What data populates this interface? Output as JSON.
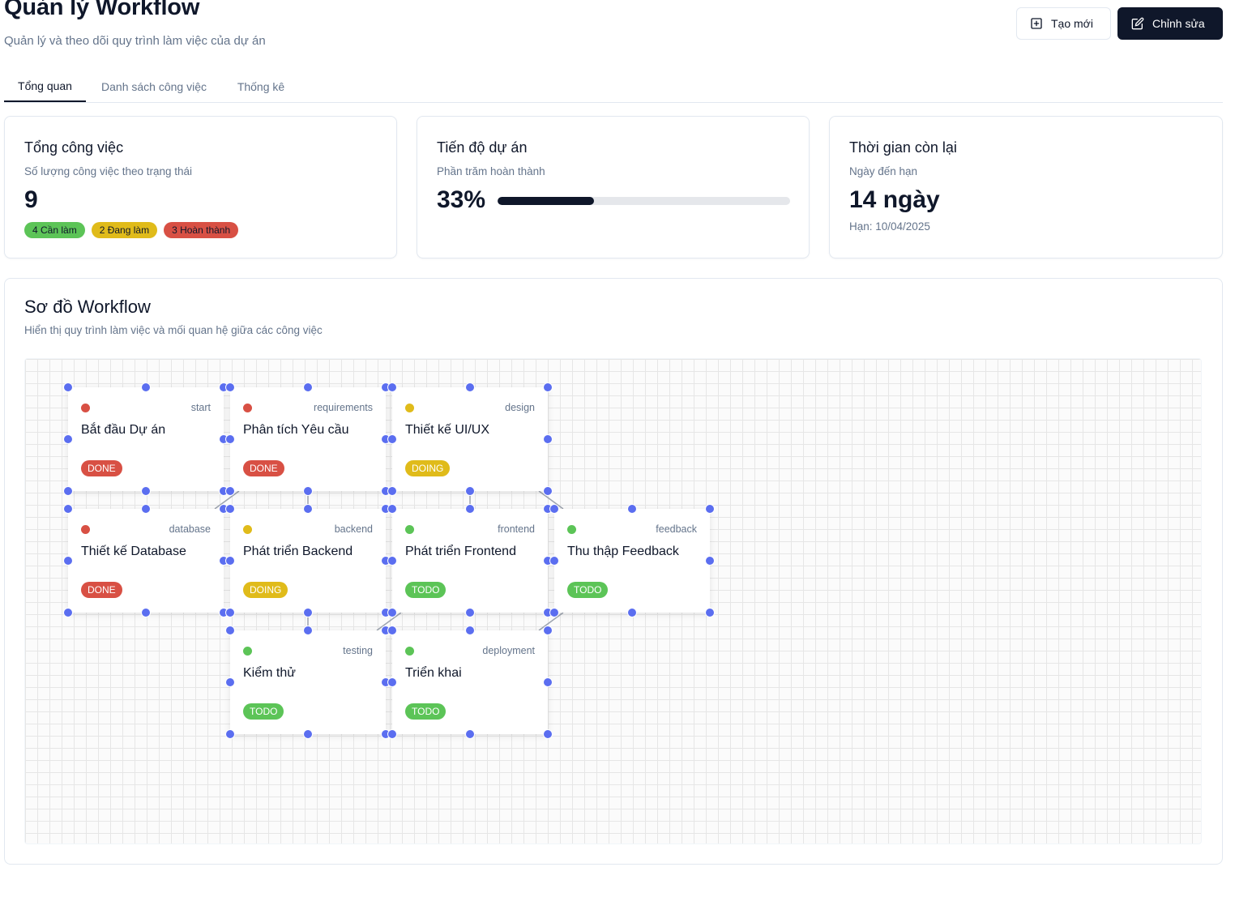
{
  "header": {
    "title": "Quản lý Workflow",
    "subtitle": "Quản lý và theo dõi quy trình làm việc của dự án",
    "new_label": "Tạo mới",
    "edit_label": "Chỉnh sửa"
  },
  "tabs": [
    {
      "label": "Tổng quan",
      "active": true
    },
    {
      "label": "Danh sách công việc",
      "active": false
    },
    {
      "label": "Thống kê",
      "active": false
    }
  ],
  "stats": {
    "total": {
      "title": "Tổng công việc",
      "desc": "Số lượng công việc theo trạng thái",
      "value": "9",
      "badges": {
        "todo": "4 Cần làm",
        "doing": "2 Đang làm",
        "done": "3 Hoàn thành"
      }
    },
    "progress": {
      "title": "Tiến độ dự án",
      "desc": "Phần trăm hoàn thành",
      "value": "33%",
      "percent": 33
    },
    "time": {
      "title": "Thời gian còn lại",
      "desc": "Ngày đến hạn",
      "value": "14 ngày",
      "deadline": "Hạn: 10/04/2025"
    }
  },
  "workflow": {
    "title": "Sơ đồ Workflow",
    "desc": "Hiển thị quy trình làm việc và mối quan hệ giữa các công việc",
    "nodes": [
      {
        "key": "start",
        "label": "Bắt đầu Dự án",
        "status": "DONE"
      },
      {
        "key": "requirements",
        "label": "Phân tích Yêu cầu",
        "status": "DONE"
      },
      {
        "key": "design",
        "label": "Thiết kế UI/UX",
        "status": "DOING"
      },
      {
        "key": "database",
        "label": "Thiết kế Database",
        "status": "DONE"
      },
      {
        "key": "backend",
        "label": "Phát triển Backend",
        "status": "DOING"
      },
      {
        "key": "frontend",
        "label": "Phát triển Frontend",
        "status": "TODO"
      },
      {
        "key": "feedback",
        "label": "Thu thập Feedback",
        "status": "TODO"
      },
      {
        "key": "testing",
        "label": "Kiểm thử",
        "status": "TODO"
      },
      {
        "key": "deployment",
        "label": "Triển khai",
        "status": "TODO"
      }
    ]
  },
  "colors": {
    "done": "#d85044",
    "doing": "#e0bb1a",
    "todo": "#5cc457",
    "handle": "#5b6ef0",
    "primary": "#0f172a"
  }
}
